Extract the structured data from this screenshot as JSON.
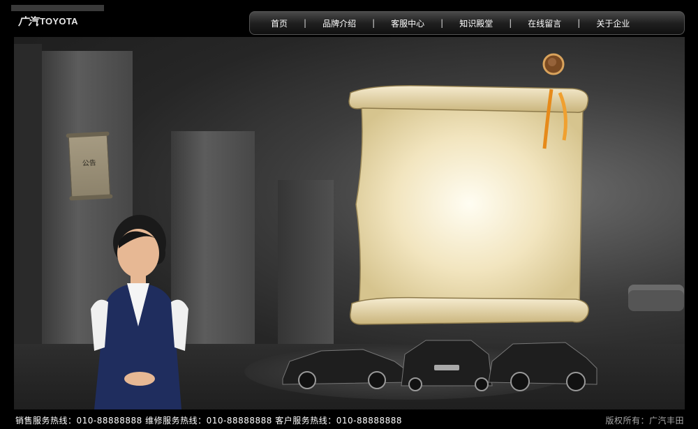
{
  "header": {
    "logo_mark": "广汽",
    "logo_brand": "TOYOTA"
  },
  "nav": {
    "items": [
      {
        "label": "首页"
      },
      {
        "label": "品牌介绍"
      },
      {
        "label": "客服中心"
      },
      {
        "label": "知识殿堂"
      },
      {
        "label": "在线留言"
      },
      {
        "label": "关于企业"
      }
    ],
    "separator": "|"
  },
  "scene": {
    "notice_text": "公告"
  },
  "footer": {
    "hotlines": "销售服务热线：010-88888888 维修服务热线：010-88888888 客户服务热线：010-88888888",
    "copyright": "版权所有：广汽丰田"
  },
  "colors": {
    "background": "#000000",
    "scroll_paper": "#f3e6c3",
    "nav_text": "#ffffff"
  }
}
